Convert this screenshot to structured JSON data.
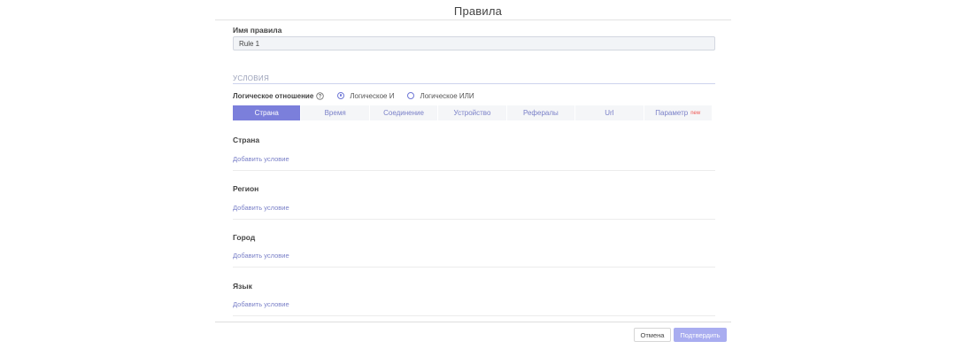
{
  "modal": {
    "title": "Правила"
  },
  "rule_name": {
    "label": "Имя правила",
    "value": "Rule 1"
  },
  "conditions": {
    "section_title": "УСЛОВИЯ",
    "logic_label": "Логическое отношение",
    "logic_options": [
      {
        "label": "Логическое И",
        "checked": true
      },
      {
        "label": "Логическое ИЛИ",
        "checked": false
      }
    ]
  },
  "tabs": [
    {
      "label": "Страна",
      "active": true
    },
    {
      "label": "Время"
    },
    {
      "label": "Соединение"
    },
    {
      "label": "Устройство"
    },
    {
      "label": "Рефералы"
    },
    {
      "label": "Url"
    },
    {
      "label": "Параметр",
      "badge": "new"
    }
  ],
  "condition_groups": [
    {
      "title": "Страна",
      "add_link": "Добавить условие"
    },
    {
      "title": "Регион",
      "add_link": "Добавить условие"
    },
    {
      "title": "Город",
      "add_link": "Добавить условие"
    },
    {
      "title": "Язык",
      "add_link": "Добавить условие"
    }
  ],
  "footer": {
    "cancel_label": "Отмена",
    "confirm_label": "Подтвердить"
  },
  "icons": {
    "help": "help-circle-icon"
  },
  "colors": {
    "accent": "#7b7fdb",
    "confirm_disabled": "#a9adf0",
    "badge_new": "#ef5350",
    "link": "#7a80c8"
  }
}
